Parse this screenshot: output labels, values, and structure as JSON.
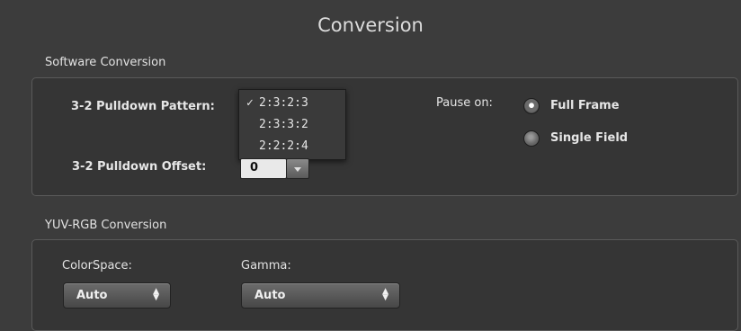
{
  "title": "Conversion",
  "software_conversion": {
    "section_label": "Software Conversion",
    "pulldown_pattern_label": "3-2 Pulldown Pattern:",
    "pulldown_pattern_options": [
      "2:3:2:3",
      "2:3:3:2",
      "2:2:2:4"
    ],
    "pulldown_pattern_checkmark": "✓",
    "pulldown_offset_label": "3-2 Pulldown Offset:",
    "pulldown_offset_value": "0",
    "pause_on_label": "Pause on:",
    "pause_options": [
      "Full Frame",
      "Single Field"
    ],
    "pause_selected": "Full Frame"
  },
  "yuv_rgb_conversion": {
    "section_label": "YUV-RGB Conversion",
    "colorspace_label": "ColorSpace:",
    "colorspace_value": "Auto",
    "gamma_label": "Gamma:",
    "gamma_value": "Auto"
  },
  "icons": {
    "select_arrows": "select-arrows-icon",
    "stepper_down": "chevron-down-icon"
  }
}
